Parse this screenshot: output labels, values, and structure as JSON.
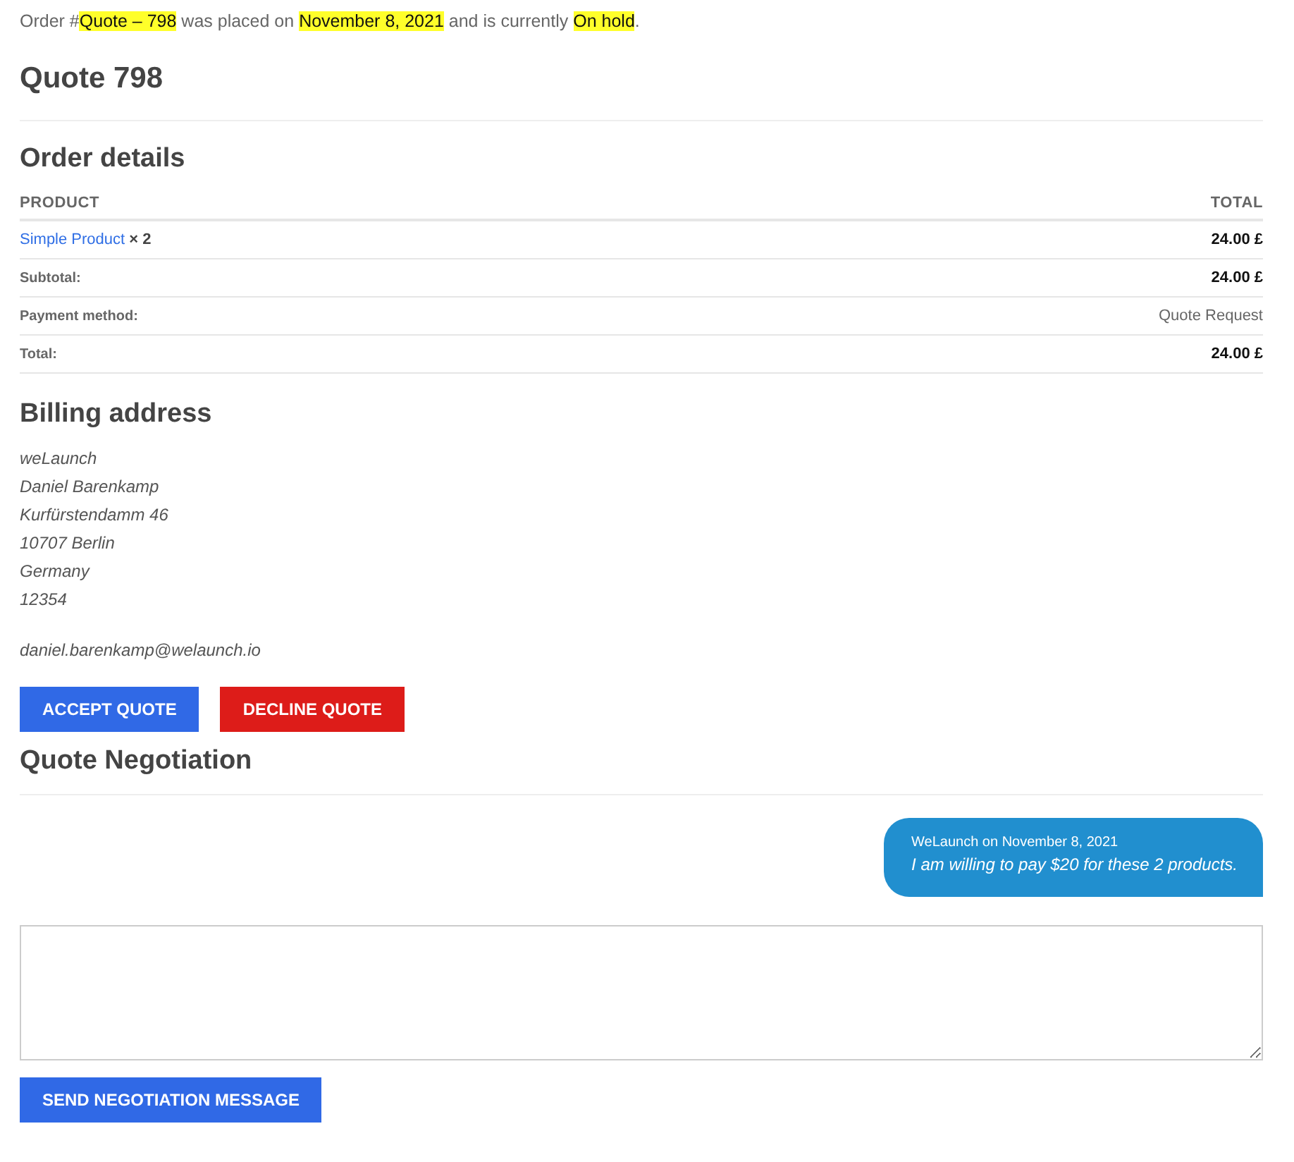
{
  "notice": [
    {
      "text": "Order #",
      "highlighted": false
    },
    {
      "text": "Quote – 798",
      "highlighted": true
    },
    {
      "text": " was placed on ",
      "highlighted": false
    },
    {
      "text": "November 8, 2021",
      "highlighted": true
    },
    {
      "text": " and is currently ",
      "highlighted": false
    },
    {
      "text": "On hold",
      "highlighted": true
    },
    {
      "text": ".",
      "highlighted": false
    }
  ],
  "page_title": "Quote 798",
  "order_details": {
    "heading": "Order details",
    "columns": [
      "PRODUCT",
      "TOTAL"
    ],
    "items": [
      {
        "product": "Simple Product",
        "quantity": "× 2",
        "total": "24.00 £"
      }
    ],
    "totals": [
      {
        "label": "Subtotal:",
        "value": "24.00 £",
        "kind": "amount"
      },
      {
        "label": "Payment method:",
        "value": "Quote Request",
        "kind": "text"
      },
      {
        "label": "Total:",
        "value": "24.00 £",
        "kind": "amount"
      }
    ]
  },
  "billing": {
    "heading": "Billing address",
    "lines": [
      "weLaunch",
      "Daniel Barenkamp",
      "Kurfürstendamm 46",
      "10707 Berlin",
      "Germany",
      "12354"
    ],
    "email": "daniel.barenkamp@welaunch.io"
  },
  "actions": [
    {
      "label": "ACCEPT QUOTE",
      "kind": "accept"
    },
    {
      "label": "DECLINE QUOTE",
      "kind": "decline"
    }
  ],
  "negotiation": {
    "heading": "Quote Negotiation",
    "messages": [
      {
        "meta": "WeLaunch on November 8, 2021",
        "text": "I am willing to pay $20 for these 2 products."
      }
    ],
    "send_button": "SEND NEGOTIATION MESSAGE"
  }
}
